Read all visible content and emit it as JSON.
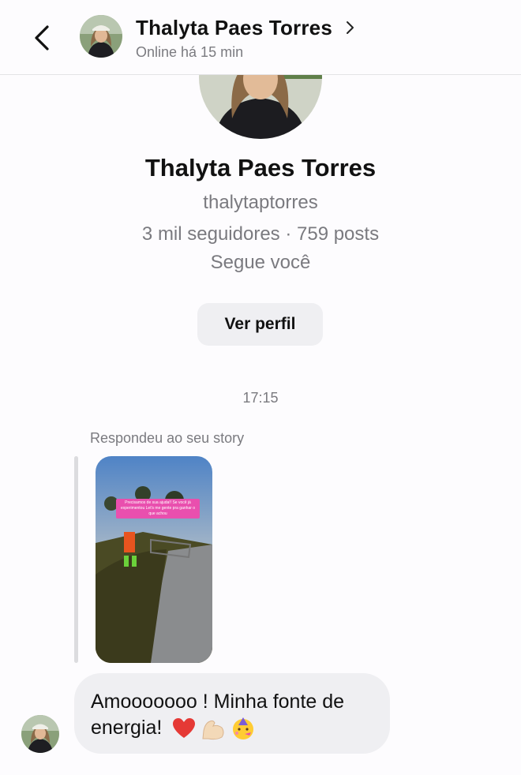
{
  "header": {
    "name": "Thalyta Paes Torres",
    "status": "Online há 15 min"
  },
  "profile": {
    "name": "Thalyta Paes Torres",
    "handle": "thalytaptorres",
    "stats": "3 mil seguidores · 759 posts",
    "follows_you": "Segue você",
    "view_profile_label": "Ver perfil"
  },
  "chat": {
    "timestamp": "17:15",
    "story_reply_label": "Respondeu ao seu story",
    "story_overlay_text": "Precisamos de sua ajuda!! Se você já experimentou Let's me gente pra ganhar o que achou",
    "message_text": "Amooooooo ! Minha fonte de energia!",
    "message_emojis": [
      "red-heart",
      "flexed-biceps",
      "partying-face"
    ]
  },
  "colors": {
    "background": "#fdfcfe",
    "bubble": "#efeff2",
    "secondary_text": "#7a7a7f",
    "heart": "#e53935"
  }
}
